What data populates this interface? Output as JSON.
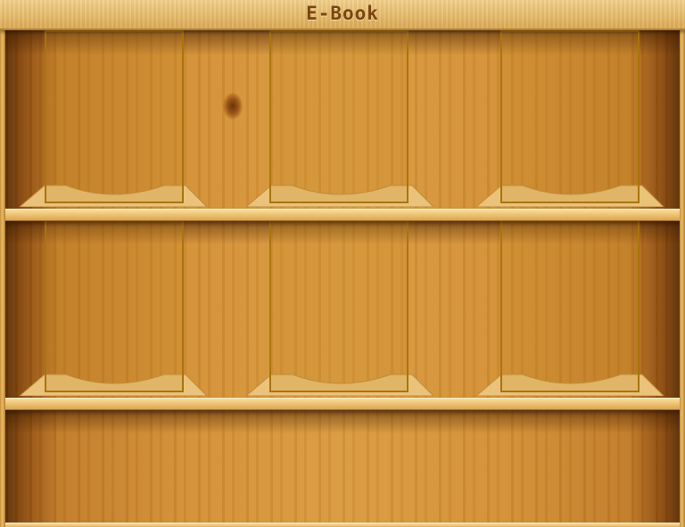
{
  "header": {
    "title": "E-Book"
  },
  "shelves": [
    {
      "slots": [
        {
          "state": "empty"
        },
        {
          "state": "empty"
        },
        {
          "state": "empty"
        }
      ]
    },
    {
      "slots": [
        {
          "state": "empty"
        },
        {
          "state": "empty"
        },
        {
          "state": "empty"
        }
      ]
    },
    {
      "slots": []
    }
  ],
  "colors": {
    "header_wood": "#e9c072",
    "title_text": "#7a4612",
    "back_wall": "#d38f36",
    "slot_border": "#a9740f",
    "board": "#efc87a"
  }
}
